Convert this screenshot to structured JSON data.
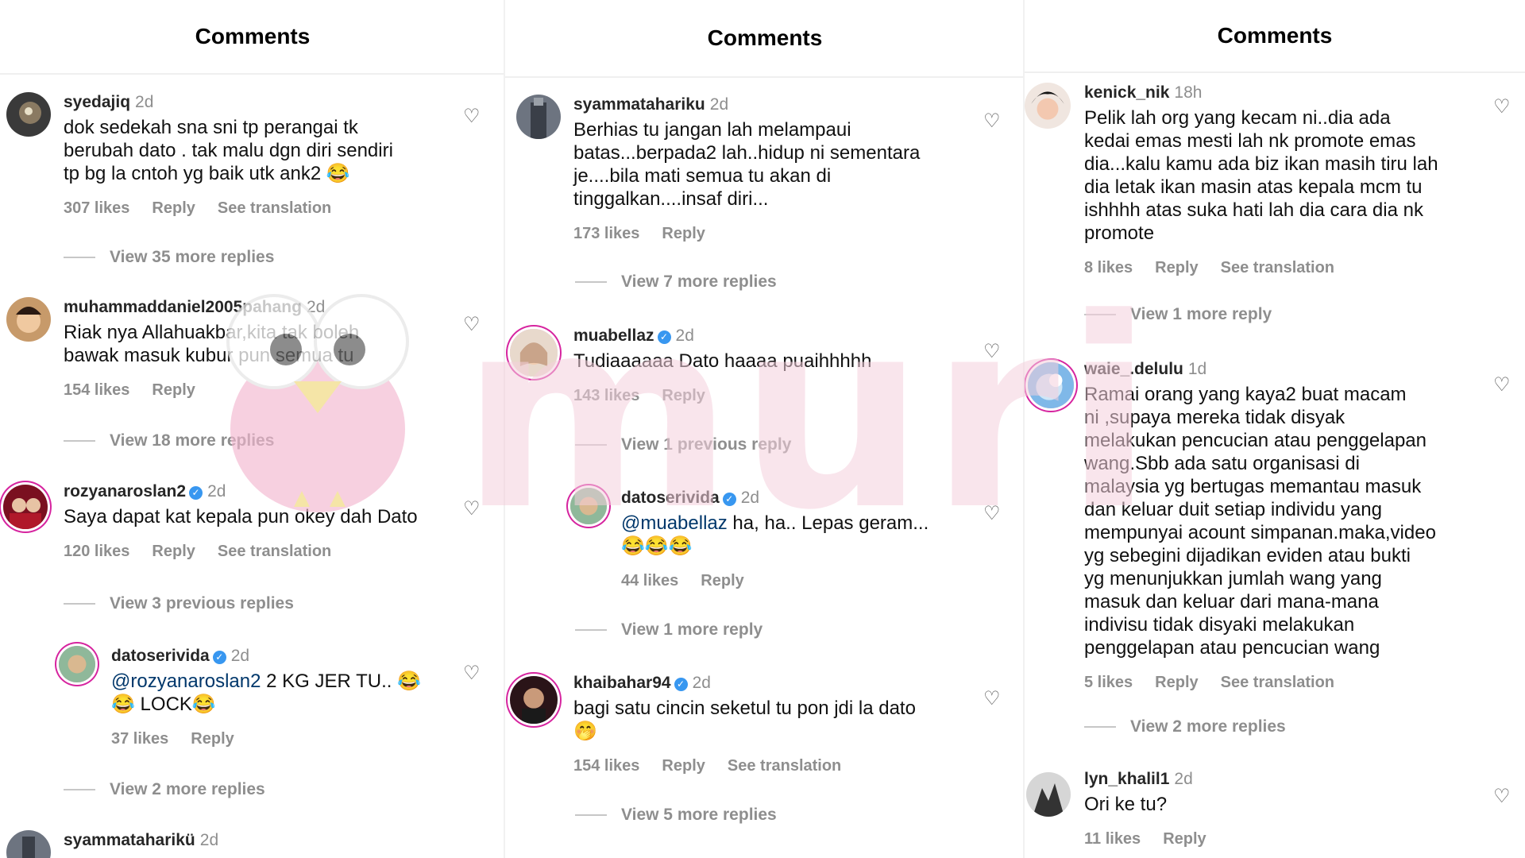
{
  "panels": [
    {
      "title": "Comments",
      "comments": [
        {
          "user": "syedajiq",
          "time": "2d",
          "verified": false,
          "mention": "",
          "text": "dok sedekah sna sni tp perangai tk\nberubah dato . tak malu dgn diri sendiri\ntp bg la cntoh yg baik utk ank2 😂",
          "likes": "307 likes",
          "reply": "Reply",
          "translation": "See translation",
          "replies": "View 35 more replies"
        },
        {
          "user": "muhammaddaniel2005pahang",
          "time": "2d",
          "verified": false,
          "mention": "",
          "text": "Riak nya Allahuakbar,kita tak boleh\nbawak masuk kubur pun semua tu",
          "likes": "154 likes",
          "reply": "Reply",
          "translation": "",
          "replies": "View 18 more replies"
        },
        {
          "user": "rozyanaroslan2",
          "time": "2d",
          "verified": true,
          "mention": "",
          "text": "Saya dapat kat kepala pun okey dah Dato",
          "likes": "120 likes",
          "reply": "Reply",
          "translation": "See translation",
          "replies": "View 3 previous replies"
        },
        {
          "user": "datoserivida",
          "time": "2d",
          "verified": true,
          "mention": "@rozyanaroslan2",
          "text": " 2 KG JER TU.. 😂\n😂 LOCK😂",
          "likes": "37 likes",
          "reply": "Reply",
          "translation": "",
          "replies": "View 2 more replies"
        },
        {
          "user": "syammataharikü",
          "time": "2d",
          "verified": false,
          "mention": "",
          "text": "",
          "likes": "",
          "reply": "",
          "translation": "",
          "replies": ""
        }
      ]
    },
    {
      "title": "Comments",
      "comments": [
        {
          "user": "syammatahariku",
          "time": "2d",
          "verified": false,
          "mention": "",
          "text": "Berhias tu jangan lah melampaui\nbatas...berpada2 lah..hidup ni sementara\nje....bila mati semua tu akan di\ntinggalkan....insaf diri...",
          "likes": "173 likes",
          "reply": "Reply",
          "translation": "",
          "replies": "View 7 more replies"
        },
        {
          "user": "muabellaz",
          "time": "2d",
          "verified": true,
          "mention": "",
          "text": "Tudiaaaaaa Dato haaaa puaihhhhh",
          "likes": "143 likes",
          "reply": "Reply",
          "translation": "",
          "replies": "View 1 previous reply"
        },
        {
          "user": "datoserivida",
          "time": "2d",
          "verified": true,
          "mention": "@muabellaz",
          "text": " ha, ha.. Lepas geram...\n😂😂😂",
          "likes": "44 likes",
          "reply": "Reply",
          "translation": "",
          "replies": "View 1 more reply"
        },
        {
          "user": "khaibahar94",
          "time": "2d",
          "verified": true,
          "mention": "",
          "text": "bagi satu cincin seketul tu pon jdi la dato\n🤭",
          "likes": "154 likes",
          "reply": "Reply",
          "translation": "See translation",
          "replies": "View 5 more replies"
        }
      ]
    },
    {
      "title": "Comments",
      "comments": [
        {
          "user": "kenick_nik",
          "time": "18h",
          "verified": false,
          "mention": "",
          "text": "Pelik lah org yang kecam ni..dia ada\nkedai emas mesti lah nk promote emas\ndia...kalu kamu ada biz ikan masih tiru lah\ndia letak ikan masin atas kepala mcm tu\nishhhh atas suka hati lah dia cara dia nk\npromote",
          "likes": "8 likes",
          "reply": "Reply",
          "translation": "See translation",
          "replies": "View 1 more reply"
        },
        {
          "user": "waie_.delulu",
          "time": "1d",
          "verified": false,
          "mention": "",
          "text": "Ramai orang yang kaya2 buat macam\nni ,supaya mereka tidak disyak\nmelakukan pencucian atau penggelapan\nwang.Sbb ada satu organisasi di\nmalaysia yg bertugas memantau masuk\ndan keluar duit setiap individu yang\nmempunyai acount simpanan.maka,video\nyg sebegini dijadikan eviden atau bukti\nyg menunjukkan jumlah wang yang\nmasuk dan keluar dari mana-mana\nindivisu tidak disyaki melakukan\npenggelapan atau pencucian wang",
          "likes": "5 likes",
          "reply": "Reply",
          "translation": "See translation",
          "replies": "View 2 more replies"
        },
        {
          "user": "lyn_khalil1",
          "time": "2d",
          "verified": false,
          "mention": "",
          "text": "Ori ke tu?",
          "likes": "11 likes",
          "reply": "Reply",
          "translation": "",
          "replies": ""
        }
      ]
    }
  ],
  "watermark": "muri",
  "colors": {
    "ring": "#d6249f",
    "verified": "#3897f0",
    "mention": "#00376b",
    "muted": "#8e8e8e",
    "watermark": "#f5d0dd"
  }
}
